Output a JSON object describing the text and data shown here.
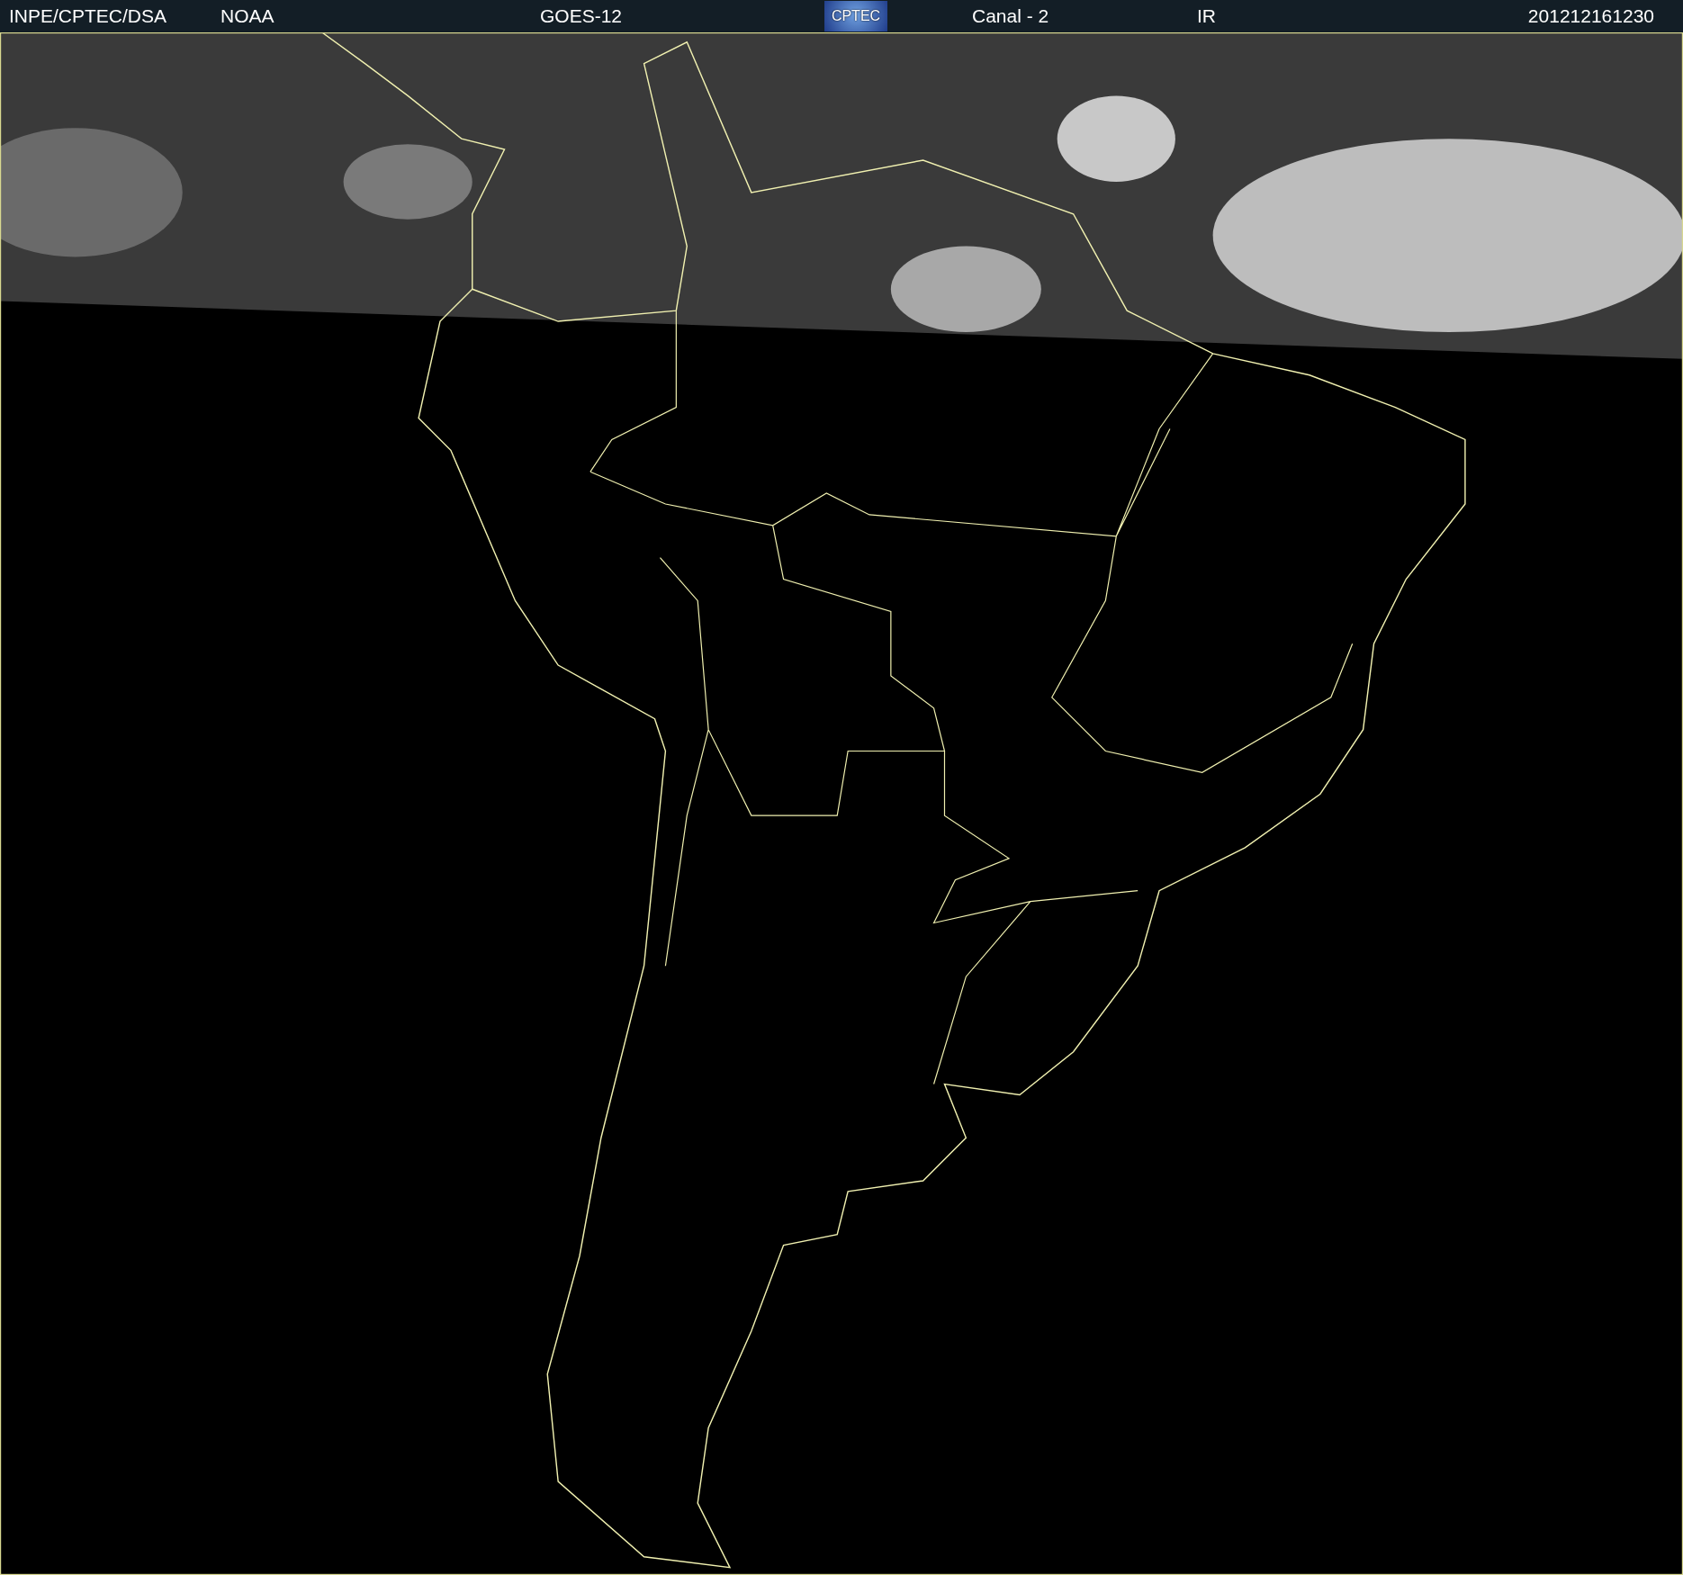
{
  "header": {
    "items": [
      {
        "kind": "text",
        "text": "INPE/CPTEC/DSA"
      },
      {
        "kind": "text",
        "text": "NOAA"
      },
      {
        "kind": "text",
        "text": "GOES-12"
      },
      {
        "kind": "logo",
        "text": "CPTEC"
      },
      {
        "kind": "text",
        "text": "Canal - 2"
      },
      {
        "kind": "text",
        "text": "IR"
      },
      {
        "kind": "text",
        "text": "201212161230"
      }
    ]
  }
}
